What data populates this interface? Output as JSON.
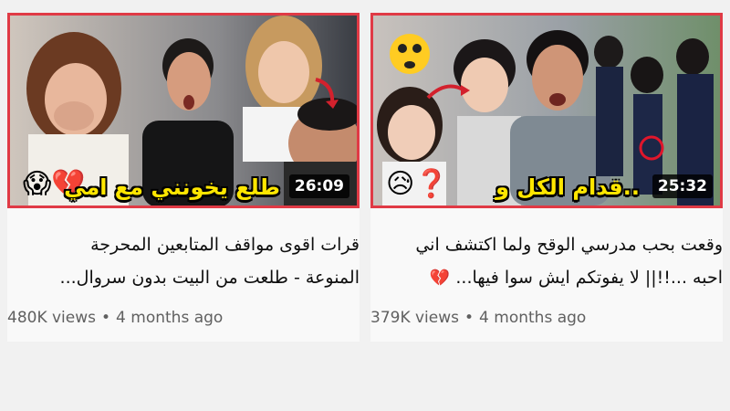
{
  "videos": [
    {
      "duration": "26:09",
      "thumbnail_text": "طلع يخونني مع امي",
      "thumbnail_emojis": "😱💔",
      "title_line1": "قرات اقوى مواقف المتابعين المحرجة",
      "title_line2": "المنوعة - طلعت من البيت بدون سروال...",
      "views": "480K views",
      "age": "4 months ago"
    },
    {
      "duration": "25:32",
      "thumbnail_text": "..قدام الكل و",
      "thumbnail_emojis": "😥❓",
      "title_line1": "وقعت بحب مدرسي الوقح ولما اكتشف اني",
      "title_line2": "احبه ...!!|| لا يفوتكم ايش سوا فيها...",
      "title_emoji": "💔",
      "views": "379K views",
      "age": "4 months ago"
    }
  ],
  "separator": "•",
  "colors": {
    "thumb_border": "#e03a45",
    "overlay_text": "#ffe600",
    "background": "#f1f1f1"
  }
}
